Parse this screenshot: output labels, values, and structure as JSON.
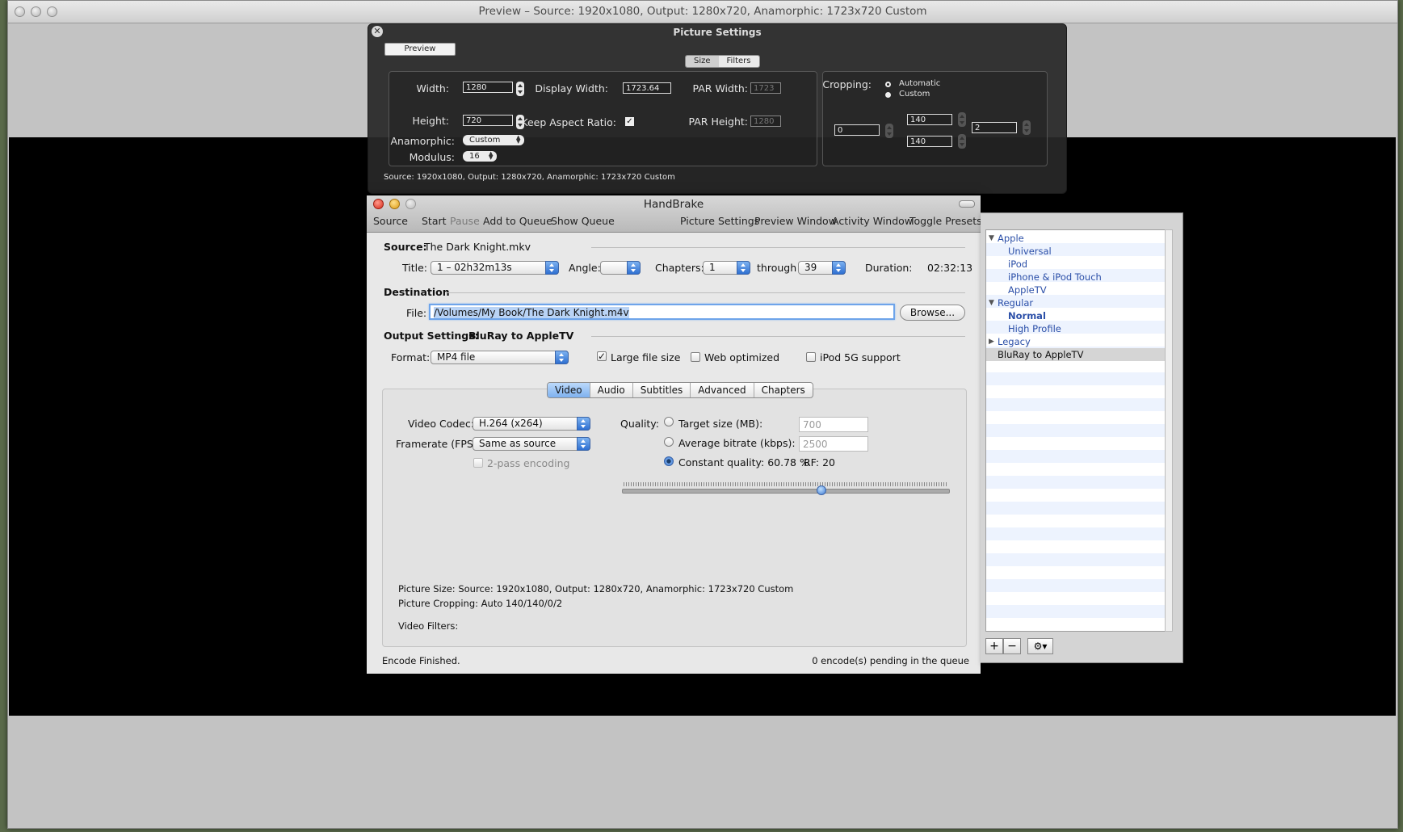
{
  "preview_window": {
    "title": "Preview – Source: 1920x1080, Output: 1280x720, Anamorphic: 1723x720 Custom"
  },
  "picture_settings": {
    "title": "Picture Settings",
    "preview_button": "Preview",
    "tabs": [
      "Size",
      "Filters"
    ],
    "width_label": "Width:",
    "width_value": "1280",
    "height_label": "Height:",
    "height_value": "720",
    "anamorphic_label": "Anamorphic:",
    "anamorphic_value": "Custom",
    "modulus_label": "Modulus:",
    "modulus_value": "16",
    "display_width_label": "Display Width:",
    "display_width_value": "1723.64",
    "keep_aspect_label": "Keep Aspect Ratio:",
    "keep_aspect_checked": true,
    "par_width_label": "PAR Width:",
    "par_width_value": "1723",
    "par_height_label": "PAR Height:",
    "par_height_value": "1280",
    "cropping_label": "Cropping:",
    "cropping_automatic": "Automatic",
    "cropping_custom": "Custom",
    "crop_left": "0",
    "crop_top": "140",
    "crop_bottom": "140",
    "crop_right": "2",
    "summary": "Source: 1920x1080, Output: 1280x720, Anamorphic: 1723x720 Custom"
  },
  "handbrake": {
    "title": "HandBrake",
    "toolbar_left": [
      "Source",
      "Start",
      "Pause",
      "Add to Queue",
      "Show Queue"
    ],
    "toolbar_right": [
      "Picture Settings",
      "Preview Window",
      "Activity Window",
      "Toggle Presets"
    ],
    "source_label": "Source:",
    "source_value": "The Dark Knight.mkv",
    "title_label": "Title:",
    "title_value": "1 – 02h32m13s",
    "angle_label": "Angle:",
    "angle_value": "",
    "chapters_label": "Chapters:",
    "chapters_from": "1",
    "through_label": "through",
    "chapters_to": "39",
    "duration_label": "Duration:",
    "duration_value": "02:32:13",
    "destination_label": "Destination",
    "file_label": "File:",
    "file_value": "/Volumes/My Book/The Dark Knight.m4v",
    "browse_button": "Browse...",
    "output_settings_label": "Output Settings:",
    "output_settings_value": "BluRay to AppleTV",
    "format_label": "Format:",
    "format_value": "MP4 file",
    "large_file_label": "Large file size",
    "large_file_checked": true,
    "web_optimized_label": "Web optimized",
    "ipod_label": "iPod 5G support",
    "tabs": [
      "Video",
      "Audio",
      "Subtitles",
      "Advanced",
      "Chapters"
    ],
    "active_tab": "Video",
    "video_codec_label": "Video Codec:",
    "video_codec_value": "H.264 (x264)",
    "framerate_label": "Framerate (FPS):",
    "framerate_value": "Same as source",
    "twopass_label": "2-pass encoding",
    "quality_label": "Quality:",
    "target_size_label": "Target size (MB):",
    "target_size_value": "700",
    "avg_bitrate_label": "Average bitrate (kbps):",
    "avg_bitrate_value": "2500",
    "constant_quality_label": "Constant quality: 60.78 %",
    "rf_label": "RF:  20",
    "quality_slider_fraction": 0.6078,
    "picture_size_info": "Picture Size: Source: 1920x1080, Output: 1280x720, Anamorphic: 1723x720 Custom",
    "picture_cropping_info": "Picture Cropping: Auto 140/140/0/2",
    "video_filters_info": "Video Filters:",
    "status_left": "Encode Finished.",
    "status_right": "0 encode(s) pending in the queue"
  },
  "presets": {
    "groups": [
      {
        "name": "Apple",
        "expanded": true,
        "items": [
          "Universal",
          "iPod",
          "iPhone & iPod Touch",
          "AppleTV"
        ]
      },
      {
        "name": "Regular",
        "expanded": true,
        "items": [
          "Normal",
          "High Profile"
        ]
      },
      {
        "name": "Legacy",
        "expanded": false,
        "items": []
      }
    ],
    "custom_selected": "BluRay to AppleTV",
    "add_button": "+",
    "remove_button": "−",
    "gear_button": "⚙▾"
  },
  "colors": {
    "accent_blue": "#3f7ad3",
    "preset_link": "#2b4fa8",
    "hud_bg": "#282828"
  }
}
